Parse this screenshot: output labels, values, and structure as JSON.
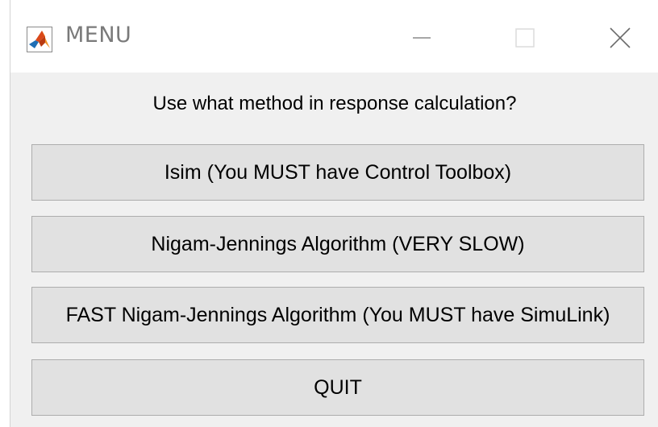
{
  "window": {
    "title": "MENU",
    "app_icon": "matlab-logo-icon",
    "controls": {
      "minimize_icon": "minimize-icon",
      "maximize_icon": "maximize-icon",
      "close_icon": "close-icon"
    }
  },
  "dialog": {
    "prompt": "Use what method in response calculation?",
    "buttons": [
      {
        "label": "Isim (You MUST have Control Toolbox)"
      },
      {
        "label": "Nigam-Jennings Algorithm (VERY SLOW)"
      },
      {
        "label": "FAST Nigam-Jennings Algorithm (You MUST have SimuLink)"
      },
      {
        "label": "QUIT"
      }
    ]
  },
  "colors": {
    "titlebar_bg": "#ffffff",
    "client_bg": "#f0f0f0",
    "button_bg": "#e1e1e1",
    "button_border": "#adadad",
    "title_text": "#7a7a7a"
  }
}
